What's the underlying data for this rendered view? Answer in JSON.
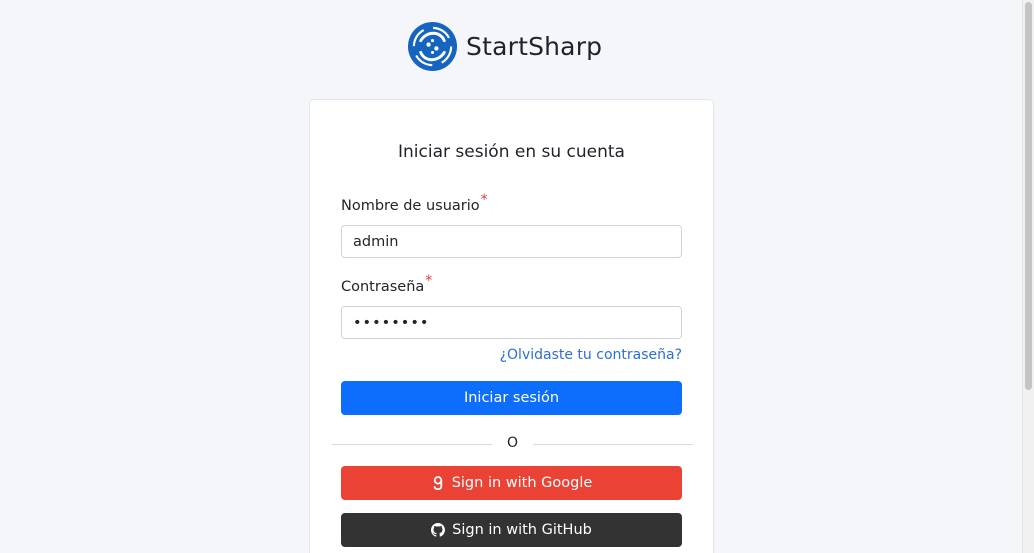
{
  "brand": {
    "name": "StartSharp",
    "logo_icon": "startsharp-logo-icon",
    "logo_color": "#1565c0"
  },
  "login": {
    "title": "Iniciar sesión en su cuenta",
    "username": {
      "label": "Nombre de usuario",
      "required_mark": "*",
      "value": "admin"
    },
    "password": {
      "label": "Contraseña",
      "required_mark": "*",
      "value": "••••••••"
    },
    "forgot_password": "¿Olvidaste tu contraseña?",
    "submit_label": "Iniciar sesión",
    "divider_text": "O",
    "google_label": "Sign in with Google",
    "github_label": "Sign in with GitHub"
  },
  "colors": {
    "primary": "#0d6efd",
    "google": "#ea4335",
    "github": "#333333",
    "link": "#2c6fd6",
    "required": "#e23b3b"
  }
}
